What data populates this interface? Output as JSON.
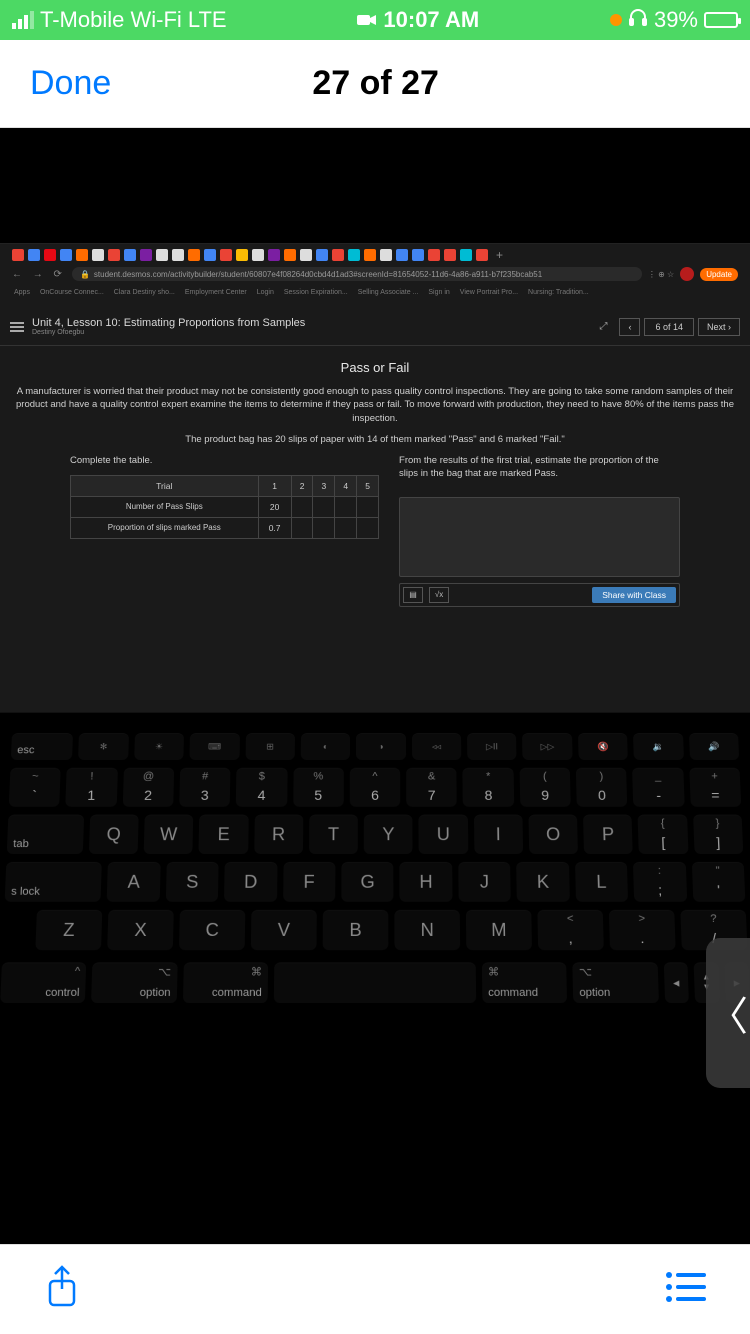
{
  "status": {
    "carrier": "T-Mobile Wi-Fi  LTE",
    "time": "10:07 AM",
    "battery_pct": "39%"
  },
  "nav": {
    "done": "Done",
    "title": "27 of 27"
  },
  "browser": {
    "url": "student.desmos.com/activitybuilder/student/60807e4f08264d0cbd4d1ad3#screenId=81654052-11d6-4a86-a911-b7f235bcab51",
    "update": "Update",
    "bookmarks": [
      "Apps",
      "OnCourse Connec...",
      "Clara Destiny sho...",
      "Employment Center",
      "Login",
      "Session Expiration...",
      "Selling Associate ...",
      "Sign in",
      "View Portrait Pro...",
      "Nursing: Tradition..."
    ]
  },
  "desmos": {
    "lesson_title": "Unit 4, Lesson 10: Estimating Proportions from Samples",
    "student": "Destiny Ofoegbu",
    "page_count": "6 of 14",
    "next": "Next",
    "section": "Pass or Fail",
    "paragraph": "A manufacturer is worried that their product may not be consistently good enough to pass quality control inspections. They are going to take some random samples of their product and have a quality control expert examine the items to determine if they pass or fail. To move forward with production, they need to have 80% of the items pass the inspection.",
    "line2": "The product bag has 20 slips of paper with 14 of them marked \"Pass\" and 6 marked \"Fail.\"",
    "complete": "Complete the table.",
    "table": {
      "headers": [
        "Trial",
        "1",
        "2",
        "3",
        "4",
        "5"
      ],
      "row1_label": "Number of Pass Slips",
      "row1_vals": [
        "20",
        "",
        "",
        "",
        ""
      ],
      "row2_label": "Proportion of slips marked Pass",
      "row2_vals": [
        "0.7",
        "",
        "",
        "",
        ""
      ]
    },
    "right_prompt": "From the results of the first trial, estimate the proportion of the slips in the bag that are marked Pass.",
    "share": "Share with Class"
  },
  "keyboard": {
    "fn_row": [
      "esc",
      "✻",
      "☀",
      "⌨",
      "⊞",
      "◐",
      "◑",
      "◃◃",
      "▷II",
      "▷▷",
      "🔇",
      "🔉",
      "🔊"
    ],
    "num_row_upper": [
      "~",
      "!",
      "@",
      "#",
      "$",
      "%",
      "^",
      "&",
      "*",
      "(",
      ")",
      "_",
      "+"
    ],
    "num_row_lower": [
      "`",
      "1",
      "2",
      "3",
      "4",
      "5",
      "6",
      "7",
      "8",
      "9",
      "0",
      "-",
      "="
    ],
    "row_q": [
      "Q",
      "W",
      "E",
      "R",
      "T",
      "Y",
      "U",
      "I",
      "O",
      "P"
    ],
    "q_tail_upper": [
      "{",
      "}"
    ],
    "q_tail_lower": [
      "[",
      "]"
    ],
    "row_a": [
      "A",
      "S",
      "D",
      "F",
      "G",
      "H",
      "J",
      "K",
      "L"
    ],
    "a_tail_upper": [
      ":",
      "\""
    ],
    "a_tail_lower": [
      ";",
      "'"
    ],
    "row_z": [
      "Z",
      "X",
      "C",
      "V",
      "B",
      "N",
      "M"
    ],
    "z_tail_upper": [
      "<",
      ">",
      "?"
    ],
    "z_tail_lower": [
      ",",
      ".",
      "/"
    ],
    "tab": "tab",
    "caps": "s lock",
    "control": "control",
    "option": "option",
    "command": "command",
    "cmd_sym": "⌘",
    "opt_sym": "⌥",
    "ctrl_sym": "^"
  },
  "swipe": "〈"
}
